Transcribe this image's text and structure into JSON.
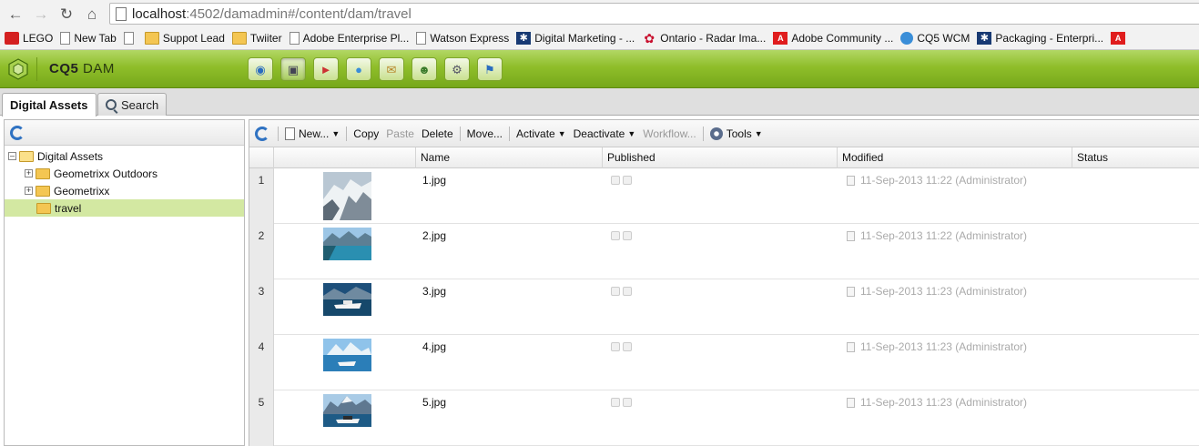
{
  "browser": {
    "url_host": "localhost",
    "url_path": ":4502/damadmin#/content/dam/travel",
    "bookmarks": [
      {
        "icon": "lego-icon",
        "label": "LEGO"
      },
      {
        "icon": "page-icon",
        "label": "New Tab"
      },
      {
        "icon": "page-icon",
        "label": ""
      },
      {
        "icon": "folder-icon",
        "label": "Suppot Lead"
      },
      {
        "icon": "folder-icon",
        "label": "Twiiter"
      },
      {
        "icon": "page-icon",
        "label": "Adobe Enterprise Pl..."
      },
      {
        "icon": "page-icon",
        "label": "Watson Express"
      },
      {
        "icon": "star-icon",
        "label": "Digital Marketing - ..."
      },
      {
        "icon": "maple-leaf-icon",
        "label": "Ontario - Radar Ima..."
      },
      {
        "icon": "adobe-icon",
        "label": "Adobe Community ..."
      },
      {
        "icon": "globe-icon",
        "label": "CQ5 WCM"
      },
      {
        "icon": "star-icon",
        "label": "Packaging - Enterpri..."
      },
      {
        "icon": "adobe-icon",
        "label": ""
      }
    ]
  },
  "app": {
    "brand": "CQ5",
    "brand_suffix": "DAM",
    "nav_icons": [
      "websites-icon",
      "digital-assets-icon",
      "campaigns-icon",
      "community-icon",
      "inbox-icon",
      "users-icon",
      "tools-icon",
      "tagging-icon"
    ]
  },
  "tabs": [
    {
      "label": "Digital Assets",
      "active": true
    },
    {
      "label": "Search",
      "active": false
    }
  ],
  "tree": {
    "root": "Digital Assets",
    "children": [
      {
        "label": "Geometrixx Outdoors",
        "expandable": true
      },
      {
        "label": "Geometrixx",
        "expandable": true
      },
      {
        "label": "travel",
        "expandable": false,
        "selected": true
      }
    ]
  },
  "toolbar": {
    "new": "New...",
    "copy": "Copy",
    "paste": "Paste",
    "delete": "Delete",
    "move": "Move...",
    "activate": "Activate",
    "deactivate": "Deactivate",
    "workflow": "Workflow...",
    "tools": "Tools"
  },
  "grid": {
    "columns": [
      "Name",
      "Published",
      "Modified",
      "Status"
    ],
    "rows": [
      {
        "num": "1",
        "name": "1.jpg",
        "modified": "11-Sep-2013 11:22 (Administrator)",
        "thumb": "mountain-ice"
      },
      {
        "num": "2",
        "name": "2.jpg",
        "modified": "11-Sep-2013 11:22 (Administrator)",
        "thumb": "fjord"
      },
      {
        "num": "3",
        "name": "3.jpg",
        "modified": "11-Sep-2013 11:23 (Administrator)",
        "thumb": "cruise-ship"
      },
      {
        "num": "4",
        "name": "4.jpg",
        "modified": "11-Sep-2013 11:23 (Administrator)",
        "thumb": "glacier-ship"
      },
      {
        "num": "5",
        "name": "5.jpg",
        "modified": "11-Sep-2013 11:23 (Administrator)",
        "thumb": "mountain-ship"
      }
    ]
  }
}
